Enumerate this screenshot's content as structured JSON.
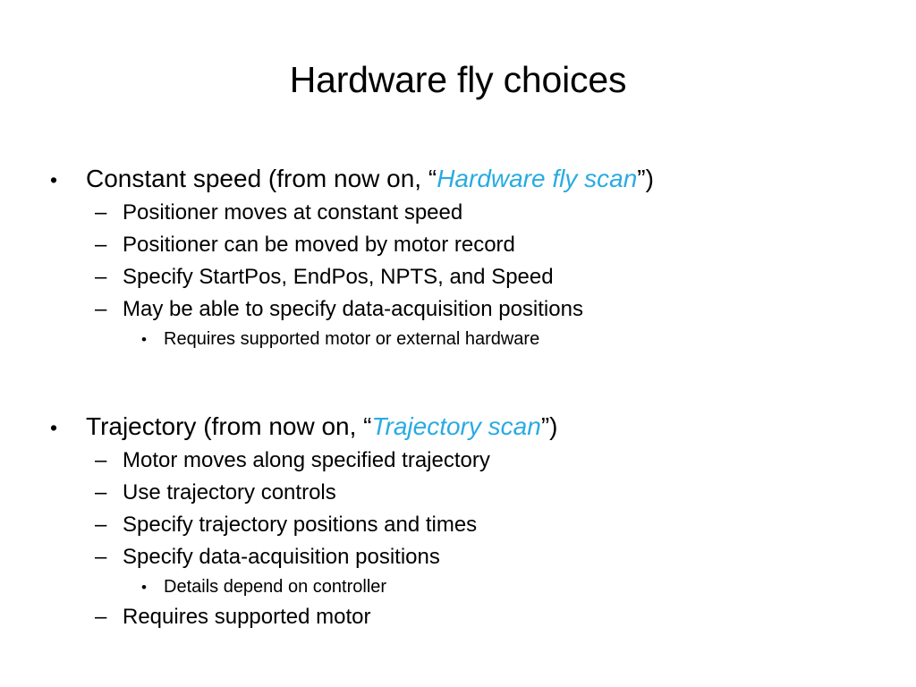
{
  "slide": {
    "title": "Hardware fly choices",
    "accent_color": "#29ABE2",
    "text_color": "#000000",
    "background_color": "#FFFFFF",
    "markers": {
      "level1": "•",
      "level2": "–",
      "level3": "•"
    },
    "groups": [
      {
        "heading": {
          "before": "Constant speed (from now on, “",
          "emphasis": "Hardware fly scan",
          "after": "”)"
        },
        "items": [
          {
            "level": 2,
            "text": "Positioner moves at constant speed"
          },
          {
            "level": 2,
            "text": "Positioner can be moved by motor record"
          },
          {
            "level": 2,
            "text": "Specify StartPos, EndPos, NPTS, and Speed"
          },
          {
            "level": 2,
            "text": "May be able to specify data-acquisition positions"
          },
          {
            "level": 3,
            "text": "Requires supported motor or external hardware"
          }
        ]
      },
      {
        "heading": {
          "before": "Trajectory (from now on, “",
          "emphasis": "Trajectory scan",
          "after": "”)"
        },
        "items": [
          {
            "level": 2,
            "text": "Motor moves along specified trajectory"
          },
          {
            "level": 2,
            "text": "Use trajectory controls"
          },
          {
            "level": 2,
            "text": "Specify trajectory positions and times"
          },
          {
            "level": 2,
            "text": "Specify data-acquisition positions"
          },
          {
            "level": 3,
            "text": "Details depend on controller"
          },
          {
            "level": 2,
            "text": "Requires supported motor"
          }
        ]
      }
    ]
  }
}
